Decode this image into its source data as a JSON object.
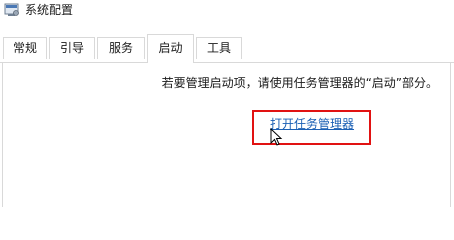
{
  "window": {
    "title": "系统配置",
    "app_icon": "system-config-icon"
  },
  "tabs": [
    {
      "label": "常规",
      "active": false
    },
    {
      "label": "引导",
      "active": false
    },
    {
      "label": "服务",
      "active": false
    },
    {
      "label": "启动",
      "active": true
    },
    {
      "label": "工具",
      "active": false
    }
  ],
  "startup": {
    "info_text": "若要管理启动项，请使用任务管理器的“启动”部分。",
    "open_task_manager_link": "打开任务管理器"
  },
  "colors": {
    "highlight_border": "#e11212",
    "link": "#1a5fb4"
  },
  "icons": {
    "cursor": "mouse-pointer-icon"
  }
}
